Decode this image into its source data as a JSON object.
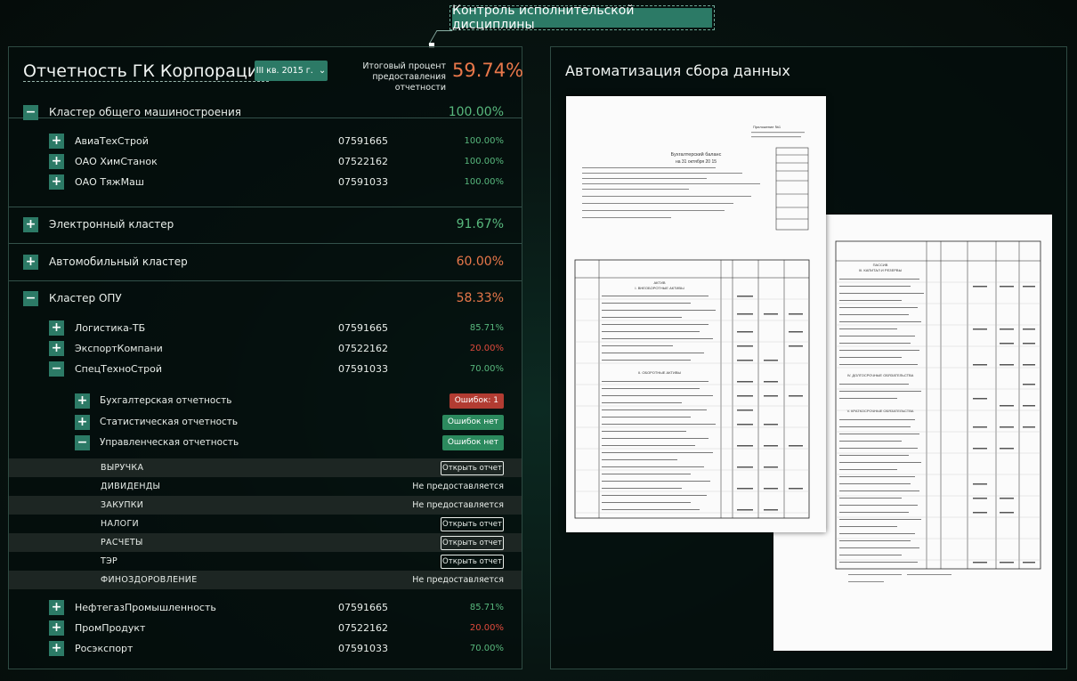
{
  "banner": "Контроль исполнительской дисциплины",
  "left": {
    "title": "Отчетность ГК Корпорация",
    "period": "III кв. 2015 г.",
    "summary_label_1": "Итоговый процент",
    "summary_label_2": "предоставления отчетности",
    "summary_value": "59.74%",
    "clusters": [
      {
        "label": "Кластер общего машиностроения",
        "pct": "100.00%",
        "toggle": "−"
      },
      {
        "label": "Электронный кластер",
        "pct": "91.67%",
        "toggle": "+"
      },
      {
        "label": "Автомобильный кластер",
        "pct": "60.00%",
        "toggle": "+"
      },
      {
        "label": "Кластер ОПУ",
        "pct": "58.33%",
        "toggle": "−"
      }
    ],
    "cluster1_companies": [
      {
        "label": "АвиаТехСтрой",
        "code": "07591665",
        "pct": "100.00%",
        "toggle": "+"
      },
      {
        "label": "ОАО ХимСтанок",
        "code": "07522162",
        "pct": "100.00%",
        "toggle": "+"
      },
      {
        "label": "ОАО ТяжМаш",
        "code": "07591033",
        "pct": "100.00%",
        "toggle": "+"
      }
    ],
    "cluster4_companies_top": [
      {
        "label": "Логистика-ТБ",
        "code": "07591665",
        "pct": "85.71%",
        "toggle": "+"
      },
      {
        "label": "ЭкспортКомпани",
        "code": "07522162",
        "pct": "20.00%",
        "toggle": "+"
      },
      {
        "label": "СпецТехноСтрой",
        "code": "07591033",
        "pct": "70.00%",
        "toggle": "−"
      }
    ],
    "reports": [
      {
        "label": "Бухгалтерская отчетность",
        "badge": "Ошибок: 1",
        "toggle": "+"
      },
      {
        "label": "Статистическая отчетность",
        "badge": "Ошибок нет",
        "toggle": "+"
      },
      {
        "label": "Управленческая отчетность",
        "badge": "Ошибок нет",
        "toggle": "−"
      }
    ],
    "indicators": [
      {
        "label": "ВЫРУЧКА",
        "status": "Открыть отчет"
      },
      {
        "label": "ДИВИДЕНДЫ",
        "status": "Не предоставляется"
      },
      {
        "label": "ЗАКУПКИ",
        "status": "Не предоставляется"
      },
      {
        "label": "НАЛОГИ",
        "status": "Открыть отчет"
      },
      {
        "label": "РАСЧЕТЫ",
        "status": "Открыть отчет"
      },
      {
        "label": "ТЭР",
        "status": "Открыть отчет"
      },
      {
        "label": "ФИНОЗДОРОВЛЕНИЕ",
        "status": "Не предоставляется"
      }
    ],
    "cluster4_companies_bottom": [
      {
        "label": "НефтегазПромышленность",
        "code": "07591665",
        "pct": "85.71%",
        "toggle": "+"
      },
      {
        "label": "ПромПродукт",
        "code": "07522162",
        "pct": "20.00%",
        "toggle": "+"
      },
      {
        "label": "Росэкспорт",
        "code": "07591033",
        "pct": "70.00%",
        "toggle": "+"
      }
    ]
  },
  "right": {
    "title": "Автоматизация сбора данных",
    "doc1": {
      "appendix": "Приложение №1",
      "heading": "Бухгалтерский баланс",
      "date": "на 31 октября 20 15",
      "section1": "АКТИВ",
      "section2": "I. ВНЕОБОРОТНЫЕ АКТИВЫ",
      "section3": "II. ОБОРОТНЫЕ АКТИВЫ"
    },
    "doc2": {
      "section1": "ПАССИВ",
      "section2": "III. КАПИТАЛ И РЕЗЕРВЫ",
      "section3": "IV. ДОЛГОСРОЧНЫЕ ОБЯЗАТЕЛЬСТВА",
      "section4": "V. КРАТКОСРОЧНЫЕ ОБЯЗАТЕЛЬСТВА"
    }
  },
  "colors": {
    "accent": "#2c7a66",
    "ok": "#2c8a5e",
    "error": "#b23c32",
    "green_pct": "#58b87d",
    "orange_pct": "#e8774a",
    "red_pct": "#e04a3c"
  }
}
